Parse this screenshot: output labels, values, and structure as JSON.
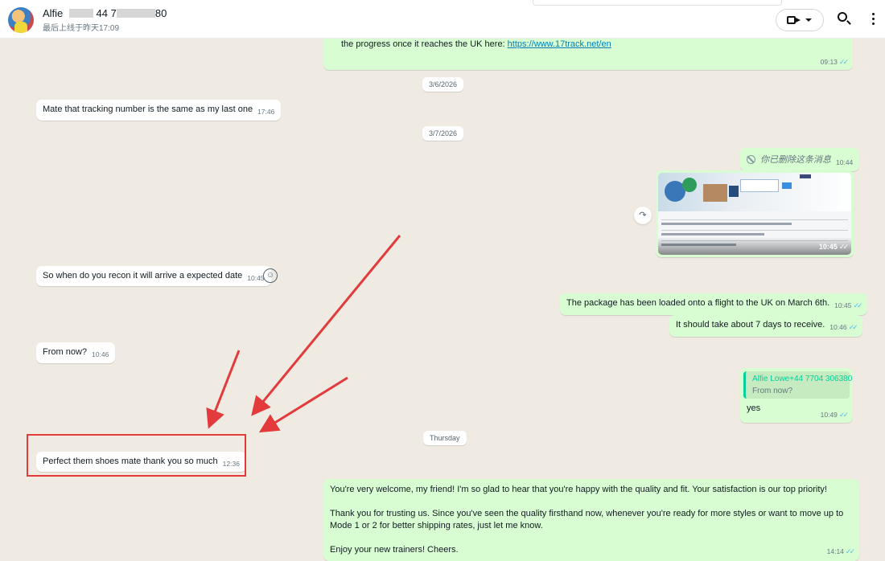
{
  "header": {
    "contact_name_prefix": "Alfie",
    "contact_phone_visible_1": "44",
    "contact_phone_visible_2": "7",
    "contact_phone_visible_3": "80",
    "last_seen": "最后上线于昨天17:09",
    "video_call_icon": "video-camera-icon",
    "dropdown_icon": "chevron-down-icon",
    "search_icon": "search-icon",
    "menu_icon": "more-vertical-icon"
  },
  "messages": {
    "m0": {
      "text_prefix": "the progress once it reaches the UK here: ",
      "link": "https://www.17track.net/en",
      "time": "09:13",
      "ticks": "✓✓"
    },
    "date1": "3/6/2026",
    "m1": {
      "text": "Mate that tracking number is the same as my last one",
      "time": "17:46"
    },
    "date2": "3/7/2026",
    "m2": {
      "text": "你已删除这条消息",
      "time": "10:44"
    },
    "m3": {
      "time": "10:45",
      "ticks": "✓✓"
    },
    "m4": {
      "text": "So when do you recon it will arrive a expected date",
      "time": "10:45"
    },
    "m5": {
      "text": "The package has been loaded onto a flight to the UK on March 6th.",
      "time": "10:45",
      "ticks": "✓✓"
    },
    "m6": {
      "text": "It should take about 7 days to receive.",
      "time": "10:46",
      "ticks": "✓✓"
    },
    "m7": {
      "text": "From now?",
      "time": "10:46"
    },
    "m8": {
      "quote_author": "Alfie Lowe+44 7704 306380",
      "quote_text": "From now?",
      "text": "yes",
      "time": "10:49",
      "ticks": "✓✓"
    },
    "date3": "Thursday",
    "m9": {
      "text": "Perfect them shoes mate thank you so much",
      "time": "12:36"
    },
    "m10": {
      "p1": "You're very welcome, my friend! I'm so glad to hear that you're happy with the quality and fit. Your satisfaction is our top priority!",
      "p2": "Thank you for trusting us. Since you've seen the quality firsthand now, whenever you're ready for more styles or want to move up to Mode 1 or 2 for better shipping rates, just let me know.",
      "p3": "Enjoy your new trainers! Cheers.",
      "time": "14:14",
      "ticks": "✓✓"
    }
  },
  "icons": {
    "forward": "↷",
    "emoji": "☺"
  },
  "colors": {
    "outgoing_bubble": "#d9fdd3",
    "incoming_bubble": "#ffffff",
    "chat_background": "#efeae2",
    "read_ticks": "#53bdeb",
    "annotation_red": "#e33b3b",
    "quote_accent": "#06cf9c"
  }
}
